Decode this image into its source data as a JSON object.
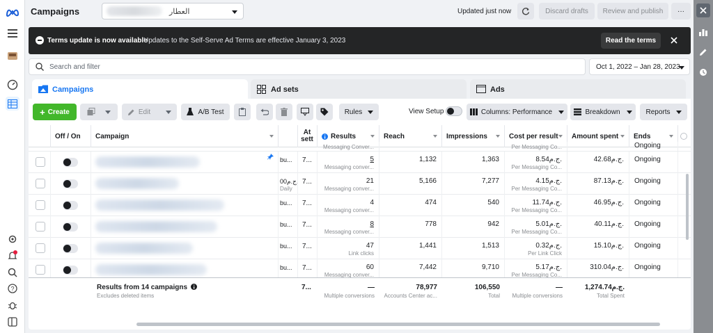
{
  "app": {
    "title": "Campaigns",
    "account_name": "العطار",
    "updated_text": "Updated just now",
    "discard_label": "Discard drafts",
    "review_label": "Review and publish",
    "more_label": "···"
  },
  "banner": {
    "title": "Terms update is now available",
    "text": "Updates to the Self-Serve Ad Terms are effective January 3, 2023",
    "button": "Read the terms"
  },
  "search": {
    "placeholder": "Search and filter",
    "date_range": "Oct 1, 2022 – Jan 28, 2023"
  },
  "tabs": [
    {
      "label": "Campaigns",
      "icon": "folder-icon",
      "active": true
    },
    {
      "label": "Ad sets",
      "icon": "grid-icon",
      "active": false
    },
    {
      "label": "Ads",
      "icon": "ad-icon",
      "active": false
    }
  ],
  "toolbar": {
    "create": "Create",
    "edit": "Edit",
    "ab_test": "A/B Test",
    "rules": "Rules",
    "view_setup": "View Setup",
    "columns": "Columns: Performance",
    "breakdown": "Breakdown",
    "reports": "Reports"
  },
  "columns": [
    "Off / On",
    "Campaign",
    "At sett",
    "Results",
    "Reach",
    "Impressions",
    "Cost per result",
    "Amount spent",
    "Ends"
  ],
  "rows": [
    {
      "bid": "bu...",
      "att": "7...",
      "results": "5",
      "results_sub": "Messaging conver...",
      "results_link": true,
      "reach": "1,132",
      "impressions": "1,363",
      "cpr": "8.54ج.م.",
      "cpr_sub": "Per Messaging Co...",
      "spent": "42.68ج.م.",
      "ends": "Ongoing",
      "name_w": 150,
      "pinned": true
    },
    {
      "bid": "00ج.م.",
      "bid_sub": "Daily",
      "att": "7...",
      "results": "21",
      "results_sub": "Messaging conver...",
      "results_link": false,
      "reach": "5,166",
      "impressions": "7,277",
      "cpr": "4.15ج.م.",
      "cpr_sub": "Per Messaging Co...",
      "spent": "87.13ج.م.",
      "ends": "Ongoing",
      "name_w": 120,
      "pinned": false
    },
    {
      "bid": "bu...",
      "att": "7...",
      "results": "4",
      "results_sub": "Messaging conver...",
      "results_link": false,
      "reach": "474",
      "impressions": "540",
      "cpr": "11.74ج.م.",
      "cpr_sub": "Per Messaging Co...",
      "spent": "46.95ج.م.",
      "ends": "Ongoing",
      "name_w": 185,
      "pinned": false
    },
    {
      "bid": "bu...",
      "att": "7...",
      "results": "8",
      "results_sub": "Messaging conver...",
      "results_link": true,
      "reach": "778",
      "impressions": "942",
      "cpr": "5.01ج.م.",
      "cpr_sub": "Per Messaging Co...",
      "spent": "40.11ج.م.",
      "ends": "Ongoing",
      "name_w": 175,
      "pinned": false
    },
    {
      "bid": "bu...",
      "att": "7...",
      "results": "47",
      "results_sub": "Link clicks",
      "results_link": false,
      "reach": "1,441",
      "impressions": "1,513",
      "cpr": "0.32ج.م.",
      "cpr_sub": "Per Link Click",
      "spent": "15.10ج.م.",
      "ends": "Ongoing",
      "name_w": 140,
      "pinned": false
    },
    {
      "bid": "bu...",
      "att": "7...",
      "results": "60",
      "results_sub": "Messaging conver...",
      "results_link": false,
      "reach": "7,442",
      "impressions": "9,710",
      "cpr": "5.17ج.م.",
      "cpr_sub": "Per Messaging Co...",
      "spent": "310.04ج.م.",
      "ends": "Ongoing",
      "name_w": 160,
      "pinned": false
    }
  ],
  "top_partial": {
    "results_sub": "Messaging Conver...",
    "cpr_sub": "Per Messaging Co...",
    "ends": "Ongoing"
  },
  "totals": {
    "title": "Results from 14 campaigns",
    "subtitle": "Excludes deleted items",
    "att": "7...",
    "results": "—",
    "results_sub": "Multiple conversions",
    "reach": "78,977",
    "reach_sub": "Accounts Center ac...",
    "impressions": "106,550",
    "impressions_sub": "Total",
    "cpr": "—",
    "cpr_sub": "Multiple conversions",
    "spent": "1,274.74ج.م.",
    "spent_sub": "Total Spent"
  }
}
